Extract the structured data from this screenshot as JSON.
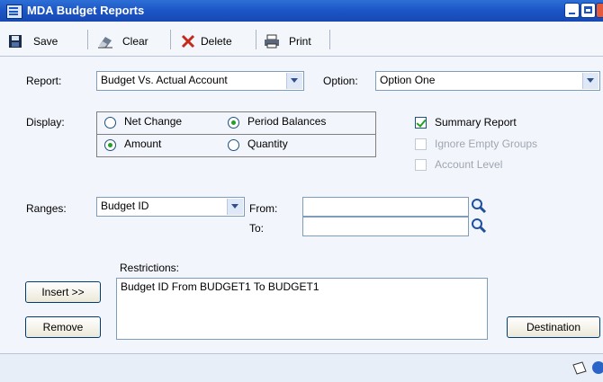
{
  "window": {
    "title": "MDA Budget Reports"
  },
  "toolbar": {
    "save": "Save",
    "clear": "Clear",
    "delete": "Delete",
    "print": "Print"
  },
  "report": {
    "label": "Report:",
    "value": "Budget Vs. Actual Account"
  },
  "option": {
    "label": "Option:",
    "value": "Option One"
  },
  "display": {
    "label": "Display:",
    "net_change": "Net Change",
    "period_balances": "Period Balances",
    "amount": "Amount",
    "quantity": "Quantity",
    "selected_top": "Period Balances",
    "selected_bottom": "Amount"
  },
  "checks": {
    "summary_report": "Summary Report",
    "ignore_empty_groups": "Ignore Empty Groups",
    "account_level": "Account Level"
  },
  "ranges": {
    "label": "Ranges:",
    "value": "Budget ID",
    "from_label": "From:",
    "to_label": "To:",
    "from_value": "",
    "to_value": ""
  },
  "restrictions": {
    "label": "Restrictions:",
    "value": "Budget ID From BUDGET1 To BUDGET1"
  },
  "buttons": {
    "insert": "Insert >>",
    "remove": "Remove",
    "destination": "Destination"
  },
  "colors": {
    "titlebar": "#1c55c6",
    "radio_dot": "#21a121",
    "accent_red": "#c42b1c"
  }
}
